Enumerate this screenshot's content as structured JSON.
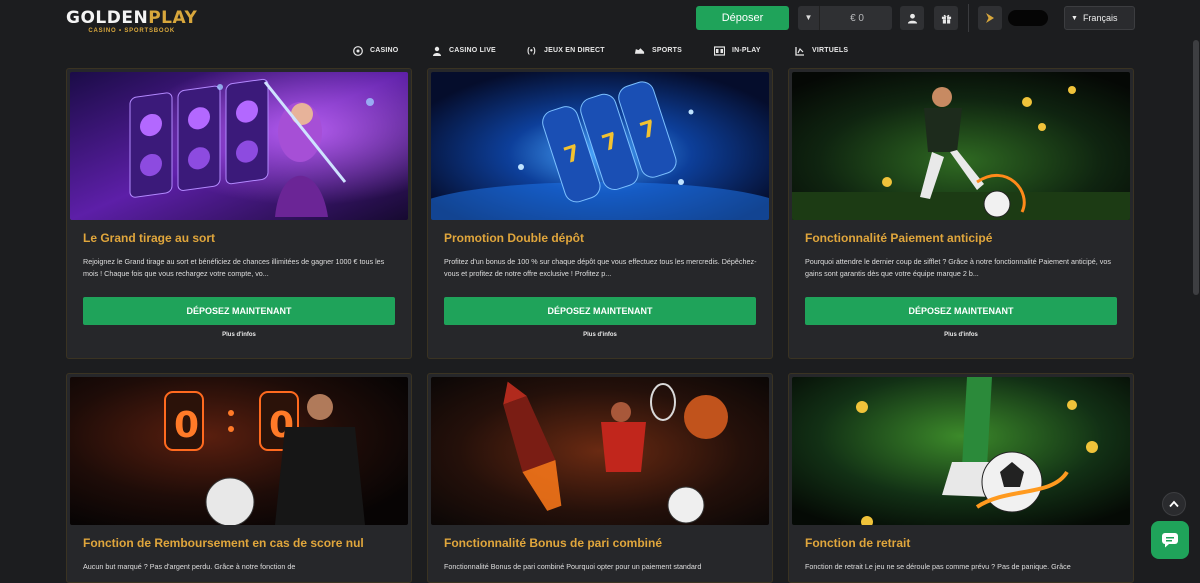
{
  "header": {
    "logo_text_main": "GOLDEN",
    "logo_text_accent": "PLAY",
    "logo_subtitle": "CASINO • SPORTSBOOK",
    "deposit_label": "Déposer",
    "balance_value": "€ 0",
    "language_label": "Français",
    "accent_color": "#1fa35a",
    "gold_color": "#d8a73c"
  },
  "nav": {
    "items": [
      {
        "label": "CASINO",
        "icon": "roulette-icon"
      },
      {
        "label": "CASINO LIVE",
        "icon": "dealer-icon"
      },
      {
        "label": "JEUX EN DIRECT",
        "icon": "live-signal-icon"
      },
      {
        "label": "SPORTS",
        "icon": "sneaker-icon"
      },
      {
        "label": "IN-PLAY",
        "icon": "scoreboard-icon"
      },
      {
        "label": "VIRTUELS",
        "icon": "virtual-icon"
      }
    ]
  },
  "promos": [
    {
      "title": "Le Grand tirage au sort",
      "description": "Rejoignez le Grand tirage au sort et bénéficiez de chances illimitées de gagner 1000 € tous les mois ! Chaque fois que vous rechargez votre compte, vo...",
      "cta": "DÉPOSEZ MAINTENANT",
      "more": "Plus d'infos",
      "image": "slot-machine-sorceress"
    },
    {
      "title": "Promotion Double dépôt",
      "description": "Profitez d'un bonus de 100 % sur chaque dépôt que vous effectuez tous les mercredis. Dépêchez-vous et profitez de notre offre exclusive ! Profitez p...",
      "cta": "DÉPOSEZ MAINTENANT",
      "more": "Plus d'infos",
      "image": "777-slot-reels-splash"
    },
    {
      "title": "Fonctionnalité Paiement anticipé",
      "description": "Pourquoi attendre le dernier coup de sifflet ? Grâce à notre fonctionnalité Paiement anticipé, vos gains sont garantis dès que votre équipe marque 2 b...",
      "cta": "DÉPOSEZ MAINTENANT",
      "more": "Plus d'infos",
      "image": "football-player-coins"
    },
    {
      "title": "Fonction de Remboursement en cas de score nul",
      "description": "Aucun but marqué ? Pas d'argent perdu. Grâce à notre fonction de",
      "image": "scoreboard-0-0-player"
    },
    {
      "title": "Fonctionnalité Bonus de pari combiné",
      "description": "Fonctionnalité Bonus de pari combiné Pourquoi opter pour un paiement standard",
      "image": "rocket-tennis-basketball"
    },
    {
      "title": "Fonction de retrait",
      "description": "Fonction de retrait Le jeu ne se déroule pas comme prévu ? Pas de panique. Grâce",
      "image": "football-boot-ball-fire"
    }
  ]
}
